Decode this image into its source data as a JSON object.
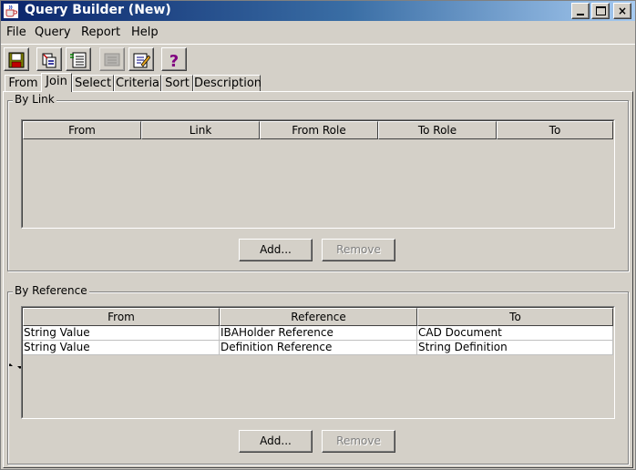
{
  "window": {
    "title": "Query Builder (New)",
    "controls": {
      "minimize": "minimize",
      "maximize": "maximize",
      "close": "×"
    }
  },
  "menu": [
    "File",
    "Query",
    "Report",
    "Help"
  ],
  "toolbar": {
    "buttons": [
      {
        "icon": "save-icon"
      },
      {
        "icon": "new-query-icon"
      },
      {
        "icon": "list-icon"
      },
      {
        "icon": "run-report-icon",
        "disabled": true
      },
      {
        "icon": "edit-icon"
      },
      {
        "icon": "help-icon",
        "label": "?"
      }
    ]
  },
  "tabs": [
    "From",
    "Join",
    "Select",
    "Criteria",
    "Sort",
    "Description"
  ],
  "active_tab": "Join",
  "by_link": {
    "title": "By Link",
    "columns": [
      "From",
      "Link",
      "From Role",
      "To Role",
      "To"
    ],
    "rows": [],
    "add_label": "Add...",
    "remove_label": "Remove"
  },
  "by_reference": {
    "title": "By Reference",
    "columns": [
      "From",
      "Reference",
      "To"
    ],
    "rows": [
      [
        "String Value",
        "IBAHolder Reference",
        "CAD Document"
      ],
      [
        "String Value",
        "Definition Reference",
        "String Definition"
      ]
    ],
    "add_label": "Add...",
    "remove_label": "Remove"
  },
  "colors": {
    "title_start": "#0a246a",
    "title_end": "#a6caf0",
    "face": "#d4d0c8",
    "help_accent": "#800080"
  }
}
